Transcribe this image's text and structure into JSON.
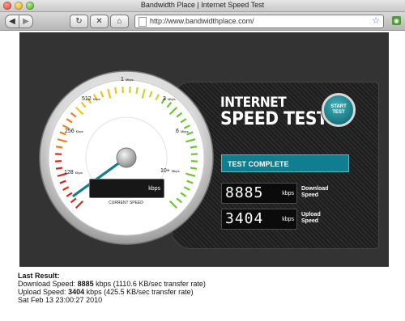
{
  "browser": {
    "window_title": "Bandwidth Place | Internet Speed Test",
    "url": "http://www.bandwidthplace.com/",
    "buttons": {
      "back": "◀",
      "forward": "▶",
      "reload": "↻",
      "stop": "✕",
      "home": "⌂"
    }
  },
  "gauge": {
    "tick_labels": [
      {
        "value": "1",
        "unit": "Mbps"
      },
      {
        "value": "512",
        "unit": "Kbps"
      },
      {
        "value": "3",
        "unit": "Mbps"
      },
      {
        "value": "256",
        "unit": "Kbps"
      },
      {
        "value": "6",
        "unit": "Mbps"
      },
      {
        "value": "128",
        "unit": "Kbps"
      },
      {
        "value": "10+",
        "unit": "Mbps"
      }
    ],
    "kbps_unit": "kbps",
    "current_speed_label": "CURRENT SPEED"
  },
  "panel": {
    "title_line1": "INTERNET",
    "title_line2": "SPEED TEST",
    "start_button": "START TEST",
    "status": "TEST COMPLETE",
    "download": {
      "value": "8885",
      "unit": "kbps",
      "label": "Download Speed"
    },
    "upload": {
      "value": "3404",
      "unit": "kbps",
      "label": "Upload Speed"
    }
  },
  "results": {
    "heading": "Last Result:",
    "download_prefix": "Download Speed:",
    "download_value": "8885",
    "download_suffix": "kbps (1110.6 KB/sec transfer rate)",
    "upload_prefix": "Upload Speed:",
    "upload_value": "3404",
    "upload_suffix": "kbps (425.5 KB/sec transfer rate)",
    "timestamp": "Sat Feb 13 23:00:27 2010"
  },
  "colors": {
    "accent_teal": "#0f7e8e",
    "widget_bg": "#333333"
  }
}
